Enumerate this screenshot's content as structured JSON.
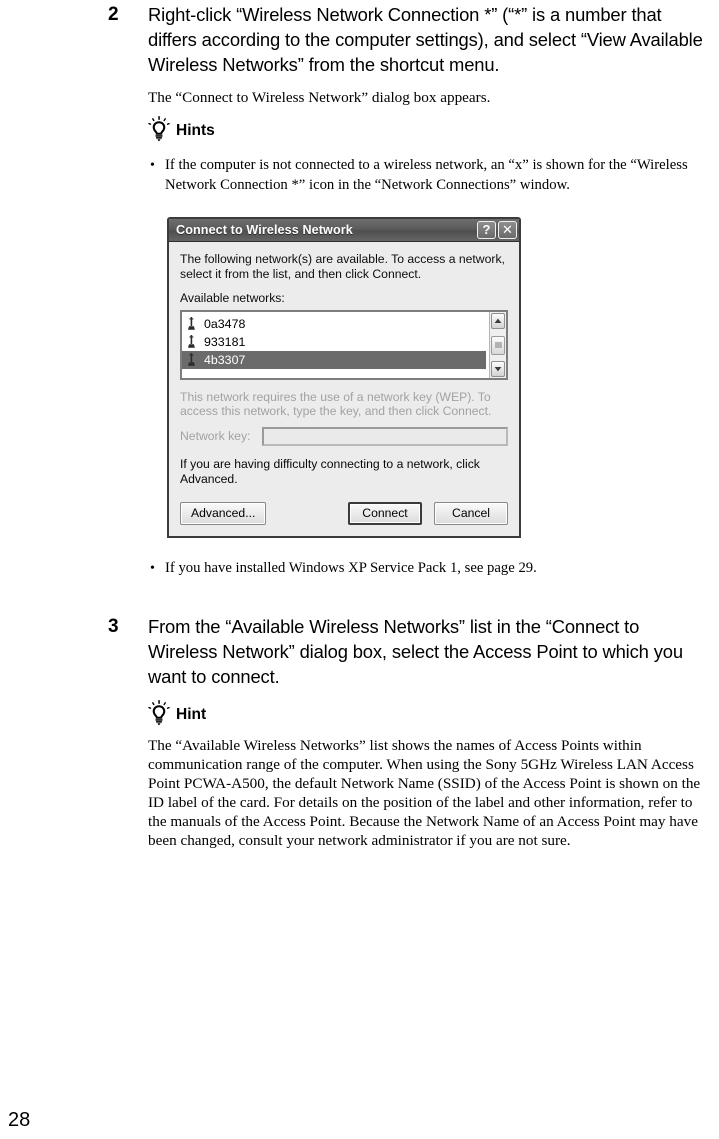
{
  "page": {
    "folio": "28"
  },
  "steps": [
    {
      "number": "2",
      "instruction": "Right-click “Wireless Network Connection *” (“*” is a number that differs according to the computer settings), and select “View Available Wireless Networks” from the shortcut menu.",
      "result": "The “Connect to Wireless Network” dialog box appears.",
      "hint_heading": "Hints",
      "bullets": [
        "If the computer is not connected to a wireless network, an “x” is shown for the “Wireless Network Connection *” icon in the “Network Connections” window.",
        "If you have installed Windows XP Service Pack 1, see page 29."
      ]
    },
    {
      "number": "3",
      "instruction": "From the “Available Wireless Networks” list in the “Connect to Wireless Network” dialog box, select the Access Point to which you want to connect.",
      "hint_heading": "Hint",
      "hint_body": "The “Available Wireless Networks” list shows the names of Access Points within communication range of the computer. When using the Sony 5GHz Wireless LAN Access Point PCWA-A500, the default Network Name (SSID) of the Access Point is shown on the ID label of the card. For details on the position of the label and other information, refer to the manuals of the Access Point. Because the Network Name of an Access Point may have been changed, consult your network administrator if you are not sure."
    }
  ],
  "dialog": {
    "title": "Connect to Wireless Network",
    "help_button": "?",
    "close_button": "✕",
    "intro": "The following network(s) are available. To access a network, select it from the list, and then click Connect.",
    "list_label": "Available networks:",
    "networks": [
      {
        "name": "0a3478",
        "selected": false
      },
      {
        "name": "933181",
        "selected": false
      },
      {
        "name": "4b3307",
        "selected": true
      }
    ],
    "wep_notice": "This network requires the use of a network key (WEP). To access this network, type the key, and then click Connect.",
    "key_label": "Network key:",
    "key_value": "",
    "advanced_note": "If you are having difficulty connecting to a network, click Advanced.",
    "buttons": {
      "advanced": "Advanced...",
      "connect": "Connect",
      "cancel": "Cancel"
    },
    "colors": {
      "titlebar": "#5b5b5b",
      "dialog_face": "#ececec",
      "selection": "#6b6b6b",
      "disabled_text": "#a2a2a2"
    }
  }
}
